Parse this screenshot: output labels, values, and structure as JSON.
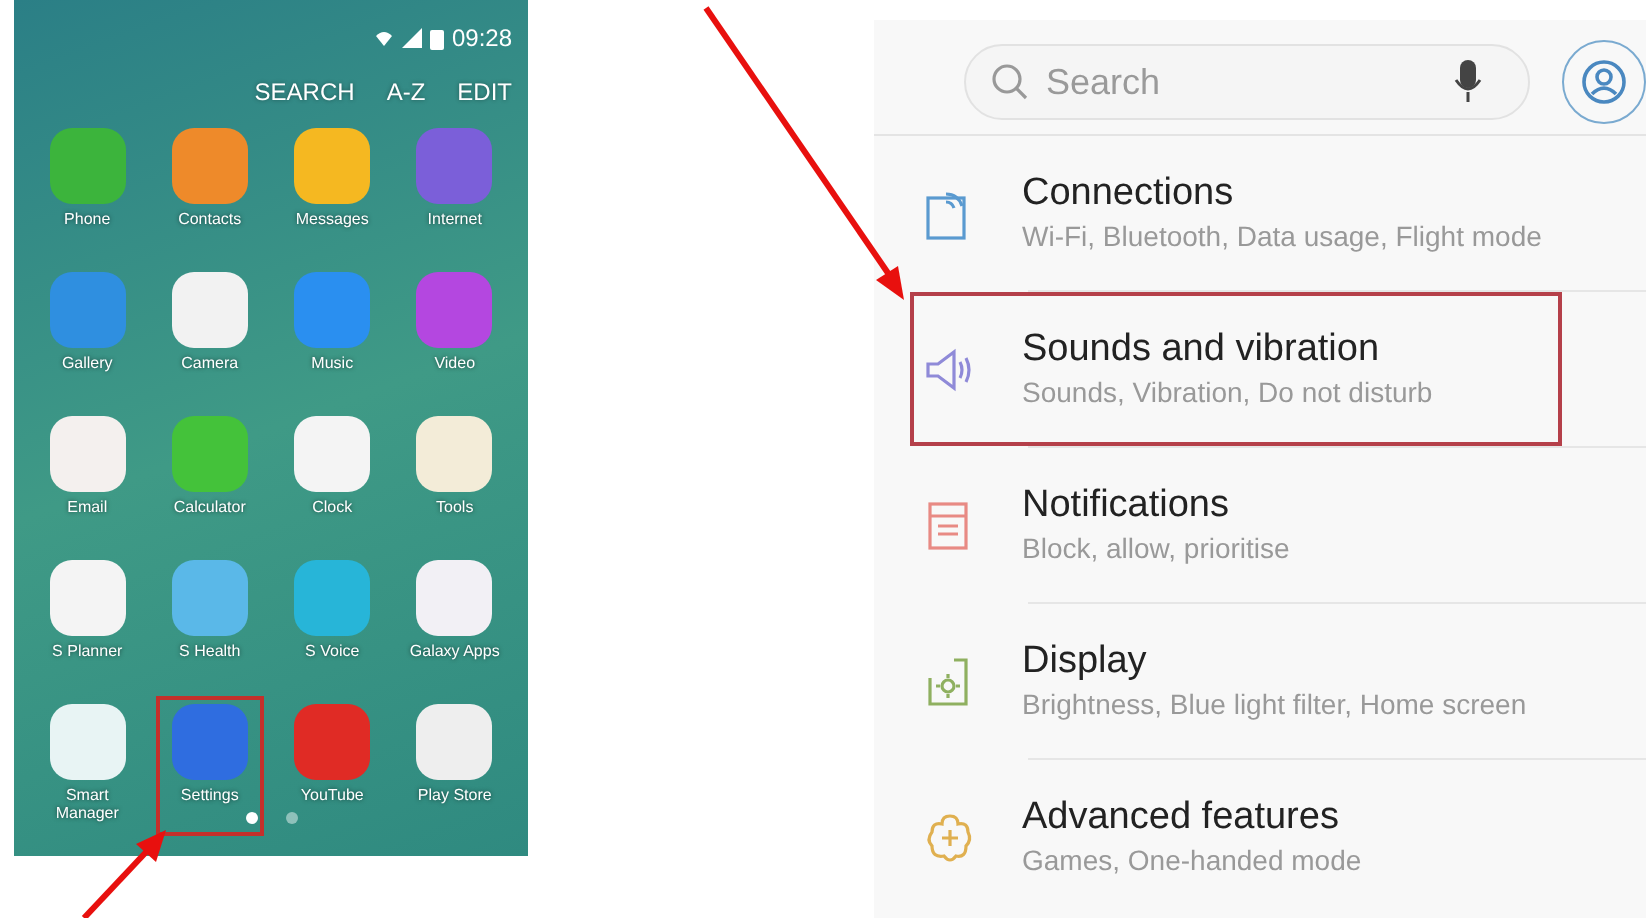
{
  "home_screen": {
    "status_time": "09:28",
    "actions": [
      "SEARCH",
      "A-Z",
      "EDIT"
    ],
    "apps": [
      {
        "label": "Phone",
        "color": "#3cb43c",
        "highlighted": false
      },
      {
        "label": "Contacts",
        "color": "#ee8a2a",
        "highlighted": false
      },
      {
        "label": "Messages",
        "color": "#f5b821",
        "highlighted": false
      },
      {
        "label": "Internet",
        "color": "#7b5fd9",
        "highlighted": false
      },
      {
        "label": "Gallery",
        "color": "#2f8fe0",
        "highlighted": false
      },
      {
        "label": "Camera",
        "color": "#f2f2f2",
        "highlighted": false
      },
      {
        "label": "Music",
        "color": "#2a8ff0",
        "highlighted": false
      },
      {
        "label": "Video",
        "color": "#b447e0",
        "highlighted": false
      },
      {
        "label": "Email",
        "color": "#f4f0ee",
        "highlighted": false
      },
      {
        "label": "Calculator",
        "color": "#44c23a",
        "highlighted": false
      },
      {
        "label": "Clock",
        "color": "#f4f4f4",
        "highlighted": false
      },
      {
        "label": "Tools",
        "color": "#f3ecd8",
        "highlighted": false
      },
      {
        "label": "S Planner",
        "color": "#f4f4f4",
        "highlighted": false
      },
      {
        "label": "S Health",
        "color": "#5ab8e8",
        "highlighted": false
      },
      {
        "label": "S Voice",
        "color": "#27b5d8",
        "highlighted": false
      },
      {
        "label": "Galaxy Apps",
        "color": "#f2f0f5",
        "highlighted": false
      },
      {
        "label": "Smart Manager",
        "color": "#e8f4f4",
        "highlighted": false
      },
      {
        "label": "Settings",
        "color": "#2f6de0",
        "highlighted": true
      },
      {
        "label": "YouTube",
        "color": "#e02b25",
        "highlighted": false
      },
      {
        "label": "Play Store",
        "color": "#eeeeee",
        "highlighted": false
      }
    ],
    "page_dots": [
      {
        "selected": true
      },
      {
        "selected": false
      }
    ]
  },
  "settings_screen": {
    "search": {
      "placeholder": "Search"
    },
    "items": [
      {
        "kind": "connections",
        "title": "Connections",
        "subtitle": "Wi-Fi, Bluetooth, Data usage, Flight mode",
        "color": "#5a9ad0",
        "highlighted": false
      },
      {
        "kind": "sound",
        "title": "Sounds and vibration",
        "subtitle": "Sounds, Vibration, Do not disturb",
        "color": "#8f8ad8",
        "highlighted": true
      },
      {
        "kind": "notifications",
        "title": "Notifications",
        "subtitle": "Block, allow, prioritise",
        "color": "#e88a84",
        "highlighted": false
      },
      {
        "kind": "display",
        "title": "Display",
        "subtitle": "Brightness, Blue light filter, Home screen",
        "color": "#8fb060",
        "highlighted": false
      },
      {
        "kind": "advanced",
        "title": "Advanced features",
        "subtitle": "Games, One-handed mode",
        "color": "#e0b050",
        "highlighted": false
      }
    ]
  }
}
